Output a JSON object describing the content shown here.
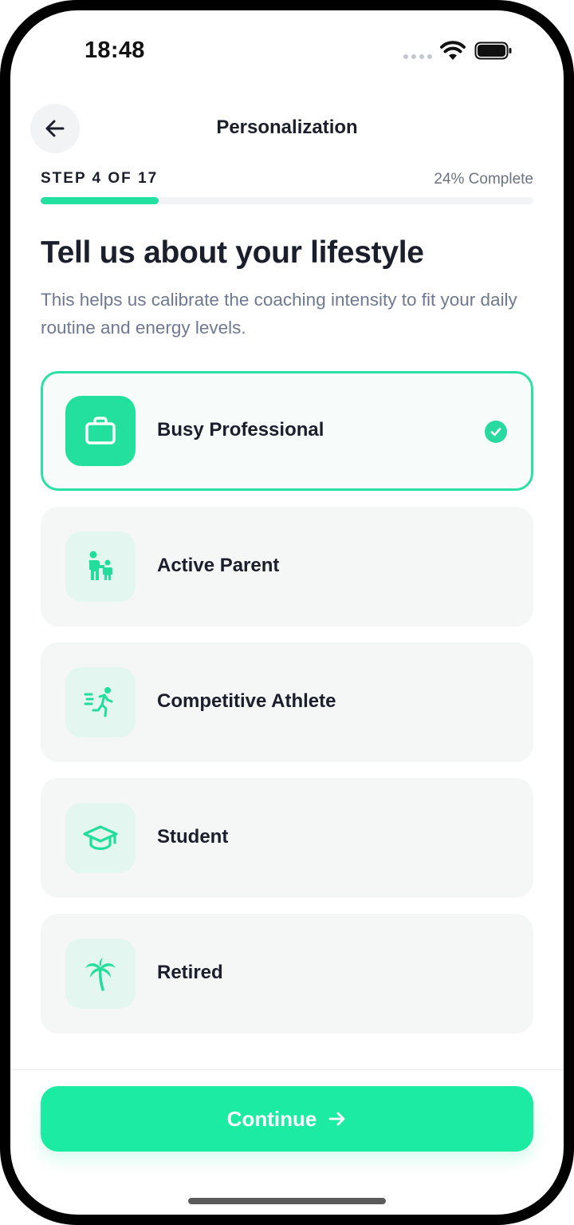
{
  "status_bar": {
    "time": "18:48"
  },
  "header": {
    "title": "Personalization"
  },
  "progress": {
    "step_label": "STEP 4 OF 17",
    "percent_label": "24% Complete",
    "fraction": 0.24
  },
  "question": {
    "heading": "Tell us about your lifestyle",
    "subtitle": "This helps us calibrate the coaching intensity to fit your daily routine and energy levels."
  },
  "options": [
    {
      "label": "Busy Professional",
      "icon": "briefcase-icon",
      "selected": true
    },
    {
      "label": "Active Parent",
      "icon": "parent-child-icon",
      "selected": false
    },
    {
      "label": "Competitive Athlete",
      "icon": "running-person-icon",
      "selected": false
    },
    {
      "label": "Student",
      "icon": "graduation-cap-icon",
      "selected": false
    },
    {
      "label": "Retired",
      "icon": "palm-tree-icon",
      "selected": false
    }
  ],
  "footer": {
    "continue_label": "Continue"
  },
  "colors": {
    "accent": "#1ceba4",
    "selected_border": "#2ce0a5",
    "text_dark": "#1b1e2b",
    "text_muted": "#6e7890"
  }
}
